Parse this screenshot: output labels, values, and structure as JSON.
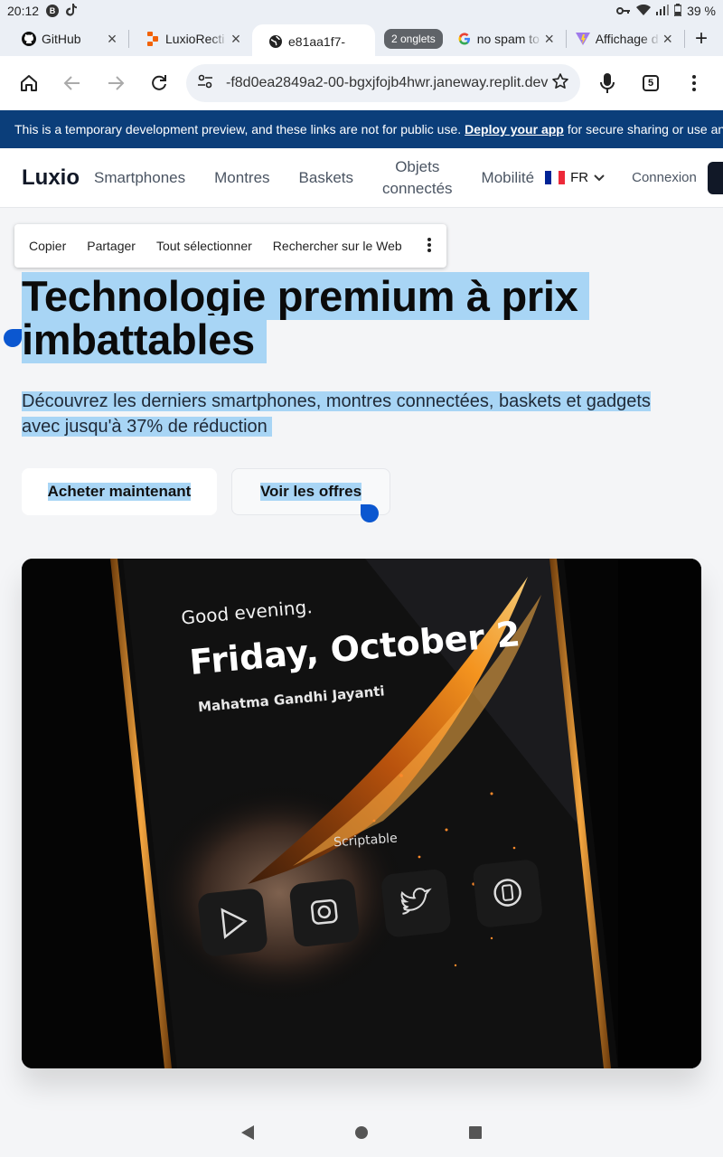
{
  "status_bar": {
    "time": "20:12",
    "battery": "39 %"
  },
  "tabs": [
    {
      "title": "GitHub",
      "icon": "github-icon",
      "active": false
    },
    {
      "title": "LuxioRecti",
      "icon": "replit-icon",
      "active": false
    },
    {
      "title": "e81aa1f7-",
      "icon": "globe-icon",
      "active": true
    },
    {
      "title": "no spam to",
      "icon": "google-icon",
      "active": false
    },
    {
      "title": "Affichage d",
      "icon": "vite-icon",
      "active": false
    }
  ],
  "tab_group_label": "2 onglets",
  "toolbar": {
    "url": "-f8d0ea2849a2-00-bgxjfojb4hwr.janeway.replit.dev",
    "tab_count": "5"
  },
  "banner": {
    "text_before": "This is a temporary development preview, and these links are not for public use.",
    "link": "Deploy your app",
    "text_after": "for secure sharing or use an in"
  },
  "header": {
    "logo": "Luxio",
    "nav": [
      "Smartphones",
      "Montres",
      "Baskets",
      "Objets connectés",
      "Mobilité"
    ],
    "lang": "FR",
    "login": "Connexion"
  },
  "context_menu": [
    "Copier",
    "Partager",
    "Tout sélectionner",
    "Rechercher sur le Web"
  ],
  "hero": {
    "title_line1": "Technologie premium à prix",
    "title_line2": "imbattables",
    "subtitle_line1": "Découvrez les derniers smartphones, montres connectées, baskets et gadgets",
    "subtitle_line2": "avec jusqu'à 37% de réduction",
    "cta_primary": "Acheter maintenant",
    "cta_secondary": "Voir les offres"
  },
  "phone_screen": {
    "greeting": "Good evening.",
    "date": "Friday, October 2",
    "holiday": "Mahatma Gandhi Jayanti",
    "widget_label": "Scriptable"
  },
  "colors": {
    "banner_bg": "#0b3e7a",
    "selection": "#a8d5f5",
    "handle": "#0b57d0",
    "flag": [
      "#002395",
      "#ffffff",
      "#ed2939"
    ]
  }
}
